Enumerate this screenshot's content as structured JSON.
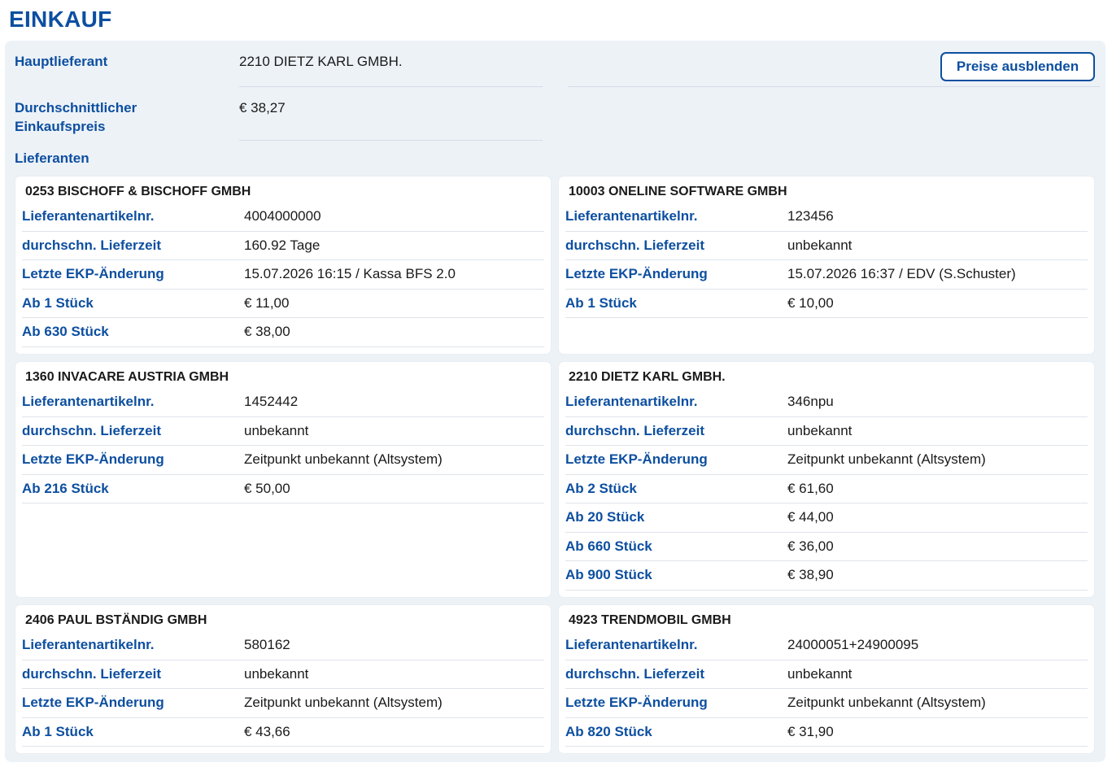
{
  "page": {
    "title": "EINKAUF",
    "hide_prices_label": "Preise ausblenden"
  },
  "summary": {
    "main_supplier_label": "Hauptlieferant",
    "main_supplier_value": "2210 DIETZ KARL GMBH.",
    "avg_price_label_line1": "Durchschnittlicher",
    "avg_price_label_line2": "Einkaufspreis",
    "avg_price_value": "€ 38,27",
    "suppliers_label": "Lieferanten"
  },
  "suppliers": [
    {
      "name": "0253 BISCHOFF & BISCHOFF GMBH",
      "rows": [
        {
          "label": "Lieferantenartikelnr.",
          "value": "4004000000"
        },
        {
          "label": "durchschn. Lieferzeit",
          "value": "160.92 Tage"
        },
        {
          "label": "Letzte EKP-Änderung",
          "value": "15.07.2026 16:15 / Kassa BFS 2.0"
        },
        {
          "label": "Ab 1 Stück",
          "value": "€ 11,00"
        },
        {
          "label": "Ab 630 Stück",
          "value": "€ 38,00"
        }
      ]
    },
    {
      "name": "10003 ONELINE SOFTWARE GMBH",
      "rows": [
        {
          "label": "Lieferantenartikelnr.",
          "value": "123456"
        },
        {
          "label": "durchschn. Lieferzeit",
          "value": "unbekannt"
        },
        {
          "label": "Letzte EKP-Änderung",
          "value": "15.07.2026 16:37 / EDV (S.Schuster)"
        },
        {
          "label": "Ab 1 Stück",
          "value": "€ 10,00"
        }
      ]
    },
    {
      "name": "1360 INVACARE AUSTRIA GMBH",
      "rows": [
        {
          "label": "Lieferantenartikelnr.",
          "value": "1452442"
        },
        {
          "label": "durchschn. Lieferzeit",
          "value": "unbekannt"
        },
        {
          "label": "Letzte EKP-Änderung",
          "value": "Zeitpunkt unbekannt (Altsystem)"
        },
        {
          "label": "Ab 216 Stück",
          "value": "€ 50,00"
        }
      ]
    },
    {
      "name": "2210 DIETZ KARL GMBH.",
      "rows": [
        {
          "label": "Lieferantenartikelnr.",
          "value": "346npu"
        },
        {
          "label": "durchschn. Lieferzeit",
          "value": "unbekannt"
        },
        {
          "label": "Letzte EKP-Änderung",
          "value": "Zeitpunkt unbekannt (Altsystem)"
        },
        {
          "label": "Ab 2 Stück",
          "value": "€ 61,60"
        },
        {
          "label": "Ab 20 Stück",
          "value": "€ 44,00"
        },
        {
          "label": "Ab 660 Stück",
          "value": "€ 36,00"
        },
        {
          "label": "Ab 900 Stück",
          "value": "€ 38,90"
        }
      ]
    },
    {
      "name": "2406 PAUL BSTÄNDIG GMBH",
      "rows": [
        {
          "label": "Lieferantenartikelnr.",
          "value": "580162"
        },
        {
          "label": "durchschn. Lieferzeit",
          "value": "unbekannt"
        },
        {
          "label": "Letzte EKP-Änderung",
          "value": "Zeitpunkt unbekannt (Altsystem)"
        },
        {
          "label": "Ab 1 Stück",
          "value": "€ 43,66"
        }
      ]
    },
    {
      "name": "4923 TRENDMOBIL GMBH",
      "rows": [
        {
          "label": "Lieferantenartikelnr.",
          "value": "24000051+24900095"
        },
        {
          "label": "durchschn. Lieferzeit",
          "value": "unbekannt"
        },
        {
          "label": "Letzte EKP-Änderung",
          "value": "Zeitpunkt unbekannt (Altsystem)"
        },
        {
          "label": "Ab 820 Stück",
          "value": "€ 31,90"
        }
      ]
    }
  ]
}
